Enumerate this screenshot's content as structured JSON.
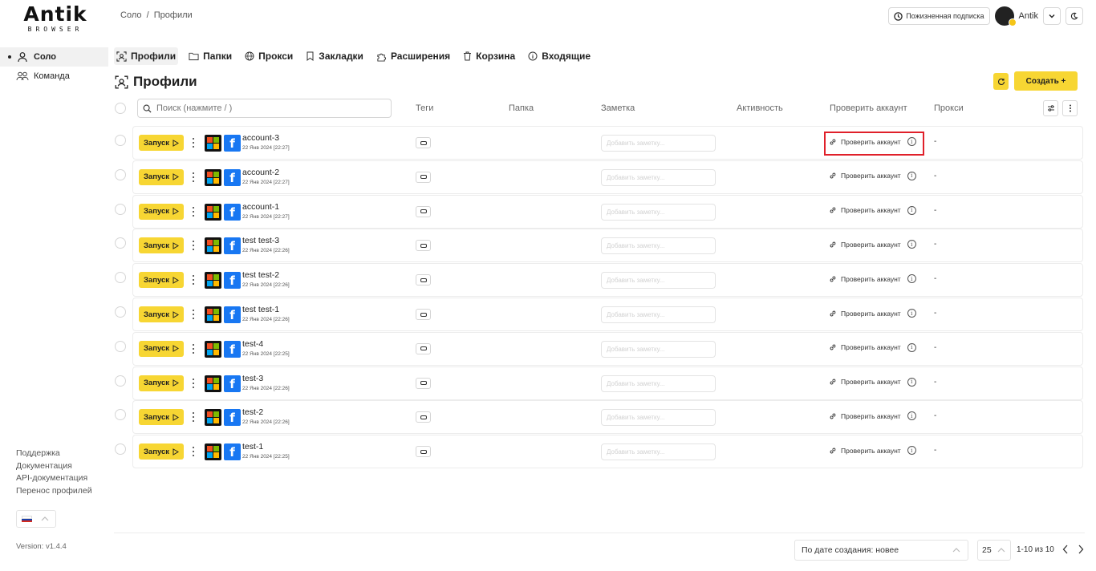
{
  "brand": {
    "name": "Antik",
    "sub": "BROWSER"
  },
  "breadcrumb": "Соло  /  Профили",
  "topbar": {
    "subscription_label": "Пожизненная подписка",
    "user_name": "Antik",
    "icons": [
      "clock-icon",
      "chevron-down-icon",
      "moon-icon"
    ]
  },
  "sidebar": {
    "items": [
      {
        "label": "Соло",
        "active": true
      },
      {
        "label": "Команда",
        "active": false
      }
    ],
    "links": [
      "Поддержка",
      "Документация",
      "API-документация",
      "Перенос профилей"
    ],
    "version": "Version: v1.4.4"
  },
  "tabs": [
    {
      "label": "Профили",
      "icon": "profiles-icon",
      "active": true
    },
    {
      "label": "Папки",
      "icon": "folder-icon",
      "active": false
    },
    {
      "label": "Прокси",
      "icon": "globe-icon",
      "active": false
    },
    {
      "label": "Закладки",
      "icon": "bookmark-icon",
      "active": false
    },
    {
      "label": "Расширения",
      "icon": "puzzle-icon",
      "active": false
    },
    {
      "label": "Корзина",
      "icon": "trash-icon",
      "active": false
    },
    {
      "label": "Входящие",
      "icon": "info-icon",
      "active": false
    }
  ],
  "page_title": "Профили",
  "create_label": "Создать +",
  "search": {
    "placeholder": "Поиск (нажмите / )"
  },
  "columns": {
    "tags": "Теги",
    "folder": "Папка",
    "note": "Заметка",
    "activity": "Активность",
    "check": "Проверить аккаунт",
    "proxy": "Прокси"
  },
  "row_labels": {
    "launch": "Запуск",
    "note_placeholder": "Добавить заметку...",
    "check_account": "Проверить аккаунт",
    "proxy_empty": "-"
  },
  "rows": [
    {
      "name": "account-3",
      "date": "22 Янв 2024 [22:27]"
    },
    {
      "name": "account-2",
      "date": "22 Янв 2024 [22:27]"
    },
    {
      "name": "account-1",
      "date": "22 Янв 2024 [22:27]"
    },
    {
      "name": "test test-3",
      "date": "22 Янв 2024 [22:26]"
    },
    {
      "name": "test test-2",
      "date": "22 Янв 2024 [22:26]"
    },
    {
      "name": "test test-1",
      "date": "22 Янв 2024 [22:26]"
    },
    {
      "name": "test-4",
      "date": "22 Янв 2024 [22:25]"
    },
    {
      "name": "test-3",
      "date": "22 Янв 2024 [22:26]"
    },
    {
      "name": "test-2",
      "date": "22 Янв 2024 [22:26]"
    },
    {
      "name": "test-1",
      "date": "22 Янв 2024 [22:25]"
    }
  ],
  "footer": {
    "sort_label": "По дате создания: новее",
    "page_size": "25",
    "range": "1-10 из 10"
  },
  "colors": {
    "accent": "#f7d633",
    "highlight": "#e0202a",
    "facebook": "#1877f2"
  }
}
